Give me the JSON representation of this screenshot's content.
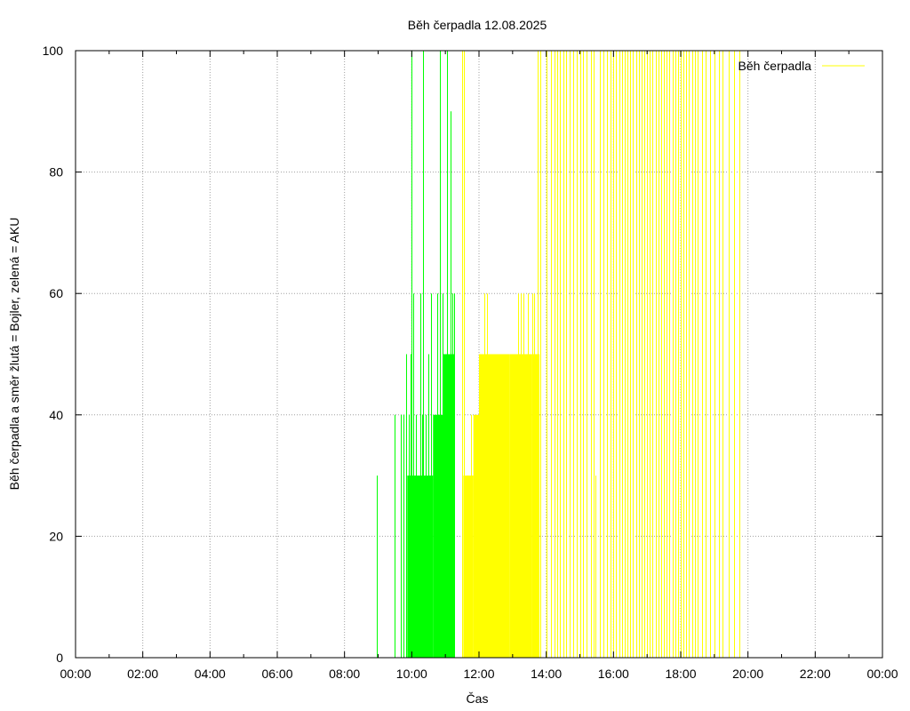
{
  "chart_data": {
    "type": "line",
    "title": "Běh čerpadla 12.08.2025",
    "xlabel": "Čas",
    "ylabel": "Běh čerpadla a směr žlutá = Bojler, zelená = AKU",
    "xlim": [
      "00:00",
      "24:00"
    ],
    "ylim": [
      0,
      100
    ],
    "x_ticks": [
      "00:00",
      "02:00",
      "04:00",
      "06:00",
      "08:00",
      "10:00",
      "12:00",
      "14:00",
      "16:00",
      "18:00",
      "20:00",
      "22:00",
      "00:00"
    ],
    "y_ticks": [
      0,
      20,
      40,
      60,
      80,
      100
    ],
    "grid": true,
    "legend_position": "top-right",
    "series": [
      {
        "name": "Běh čerpadla",
        "color": "#ffff00",
        "segments": [
          {
            "from": "11:32",
            "to": "11:50",
            "value": 30
          },
          {
            "from": "11:50",
            "to": "12:00",
            "value": 40
          },
          {
            "from": "12:00",
            "to": "12:55",
            "value": 50
          },
          {
            "from": "12:55",
            "to": "13:35",
            "value": 50
          },
          {
            "from": "13:35",
            "to": "13:48",
            "value": 50
          }
        ],
        "spikes": [
          {
            "x": "11:30",
            "y": 100
          },
          {
            "x": "11:33",
            "y": 100
          },
          {
            "x": "11:40",
            "y": 30
          },
          {
            "x": "11:45",
            "y": 40
          },
          {
            "x": "12:03",
            "y": 50
          },
          {
            "x": "12:10",
            "y": 60
          },
          {
            "x": "12:14",
            "y": 60
          },
          {
            "x": "12:30",
            "y": 40
          },
          {
            "x": "12:35",
            "y": 50
          },
          {
            "x": "12:38",
            "y": 40
          },
          {
            "x": "12:40",
            "y": 50
          },
          {
            "x": "12:45",
            "y": 40
          },
          {
            "x": "12:50",
            "y": 50
          },
          {
            "x": "12:55",
            "y": 40
          },
          {
            "x": "13:00",
            "y": 50
          },
          {
            "x": "13:03",
            "y": 40
          },
          {
            "x": "13:08",
            "y": 50
          },
          {
            "x": "13:10",
            "y": 60
          },
          {
            "x": "13:15",
            "y": 60
          },
          {
            "x": "13:20",
            "y": 60
          },
          {
            "x": "13:23",
            "y": 50
          },
          {
            "x": "13:28",
            "y": 60
          },
          {
            "x": "13:35",
            "y": 60
          },
          {
            "x": "13:38",
            "y": 60
          },
          {
            "x": "13:45",
            "y": 100
          },
          {
            "x": "13:50",
            "y": 100
          },
          {
            "x": "14:00",
            "y": 100
          },
          {
            "x": "14:08",
            "y": 100
          },
          {
            "x": "14:15",
            "y": 100
          },
          {
            "x": "14:20",
            "y": 100
          },
          {
            "x": "14:25",
            "y": 100
          },
          {
            "x": "14:30",
            "y": 100
          },
          {
            "x": "14:35",
            "y": 100
          },
          {
            "x": "14:42",
            "y": 100
          },
          {
            "x": "14:48",
            "y": 100
          },
          {
            "x": "14:55",
            "y": 100
          },
          {
            "x": "15:00",
            "y": 100
          },
          {
            "x": "15:05",
            "y": 100
          },
          {
            "x": "15:12",
            "y": 100
          },
          {
            "x": "15:20",
            "y": 100
          },
          {
            "x": "15:25",
            "y": 100
          },
          {
            "x": "15:28",
            "y": 30
          },
          {
            "x": "15:35",
            "y": 100
          },
          {
            "x": "15:42",
            "y": 100
          },
          {
            "x": "15:48",
            "y": 100
          },
          {
            "x": "15:55",
            "y": 100
          },
          {
            "x": "16:00",
            "y": 100
          },
          {
            "x": "16:05",
            "y": 100
          },
          {
            "x": "16:10",
            "y": 100
          },
          {
            "x": "16:15",
            "y": 100
          },
          {
            "x": "16:20",
            "y": 100
          },
          {
            "x": "16:25",
            "y": 100
          },
          {
            "x": "16:30",
            "y": 100
          },
          {
            "x": "16:35",
            "y": 100
          },
          {
            "x": "16:40",
            "y": 100
          },
          {
            "x": "16:45",
            "y": 100
          },
          {
            "x": "16:50",
            "y": 100
          },
          {
            "x": "16:55",
            "y": 100
          },
          {
            "x": "17:00",
            "y": 100
          },
          {
            "x": "17:05",
            "y": 100
          },
          {
            "x": "17:10",
            "y": 100
          },
          {
            "x": "17:15",
            "y": 100
          },
          {
            "x": "17:20",
            "y": 100
          },
          {
            "x": "17:25",
            "y": 100
          },
          {
            "x": "17:30",
            "y": 100
          },
          {
            "x": "17:35",
            "y": 100
          },
          {
            "x": "17:40",
            "y": 100
          },
          {
            "x": "17:45",
            "y": 100
          },
          {
            "x": "17:50",
            "y": 100
          },
          {
            "x": "17:55",
            "y": 100
          },
          {
            "x": "18:00",
            "y": 100
          },
          {
            "x": "18:05",
            "y": 100
          },
          {
            "x": "18:10",
            "y": 100
          },
          {
            "x": "18:15",
            "y": 100
          },
          {
            "x": "18:20",
            "y": 100
          },
          {
            "x": "18:25",
            "y": 100
          },
          {
            "x": "18:30",
            "y": 100
          },
          {
            "x": "18:38",
            "y": 100
          },
          {
            "x": "18:45",
            "y": 100
          },
          {
            "x": "18:52",
            "y": 100
          },
          {
            "x": "19:00",
            "y": 100
          },
          {
            "x": "19:08",
            "y": 100
          },
          {
            "x": "19:15",
            "y": 100
          },
          {
            "x": "19:25",
            "y": 100
          },
          {
            "x": "19:35",
            "y": 100
          },
          {
            "x": "19:45",
            "y": 100
          }
        ]
      },
      {
        "color": "#00ff00",
        "segments": [
          {
            "from": "09:52",
            "to": "10:20",
            "value": 30
          },
          {
            "from": "10:20",
            "to": "10:38",
            "value": 30
          },
          {
            "from": "10:38",
            "to": "10:55",
            "value": 40
          },
          {
            "from": "10:55",
            "to": "11:17",
            "value": 50
          }
        ],
        "spikes": [
          {
            "x": "08:57",
            "y": 30
          },
          {
            "x": "09:30",
            "y": 40
          },
          {
            "x": "09:40",
            "y": 40
          },
          {
            "x": "09:45",
            "y": 40
          },
          {
            "x": "09:50",
            "y": 50
          },
          {
            "x": "09:55",
            "y": 40
          },
          {
            "x": "09:58",
            "y": 50
          },
          {
            "x": "10:00",
            "y": 100
          },
          {
            "x": "10:03",
            "y": 60
          },
          {
            "x": "10:08",
            "y": 40
          },
          {
            "x": "10:15",
            "y": 60
          },
          {
            "x": "10:18",
            "y": 40
          },
          {
            "x": "10:20",
            "y": 100
          },
          {
            "x": "10:25",
            "y": 40
          },
          {
            "x": "10:30",
            "y": 50
          },
          {
            "x": "10:35",
            "y": 60
          },
          {
            "x": "10:40",
            "y": 40
          },
          {
            "x": "10:45",
            "y": 60
          },
          {
            "x": "10:48",
            "y": 40
          },
          {
            "x": "10:50",
            "y": 100
          },
          {
            "x": "10:55",
            "y": 60
          },
          {
            "x": "11:00",
            "y": 50
          },
          {
            "x": "11:03",
            "y": 100
          },
          {
            "x": "11:07",
            "y": 50
          },
          {
            "x": "11:10",
            "y": 90
          },
          {
            "x": "11:12",
            "y": 60
          },
          {
            "x": "11:15",
            "y": 60
          }
        ]
      }
    ]
  }
}
